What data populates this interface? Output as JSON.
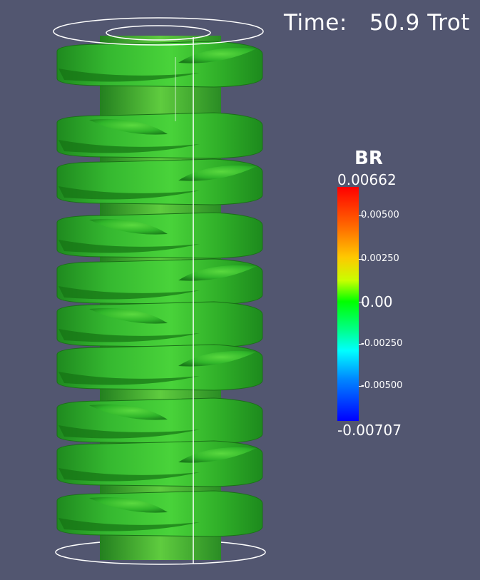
{
  "overlay": {
    "time_label": "Time:",
    "time_value": "50.9 Trot"
  },
  "colorbar": {
    "title": "BR",
    "max_label": "0.00662",
    "min_label": "-0.00707",
    "ticks": [
      "0.00500",
      "0.00250",
      "0.00",
      "-0.00250",
      "-0.00500"
    ],
    "colors": [
      "#ff0000",
      "#ffc800",
      "#00ff00",
      "#00ffff",
      "#0000ff"
    ]
  },
  "scene": {
    "isosurface_color": "#2fbf1f",
    "background": "#525670"
  }
}
